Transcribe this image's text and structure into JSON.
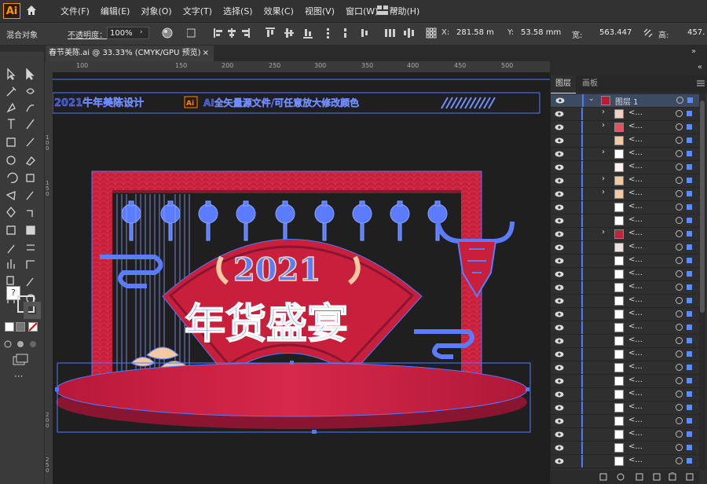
{
  "app": {
    "logo": "Ai"
  },
  "menu": [
    "文件(F)",
    "编辑(E)",
    "对象(O)",
    "文字(T)",
    "选择(S)",
    "效果(C)",
    "视图(V)",
    "窗口(W)",
    "帮助(H)"
  ],
  "control": {
    "mode": "混合对象",
    "opacity_label": "不透明度：",
    "opacity_value": "100%",
    "x_label": "X:",
    "x_value": "281.58 m",
    "y_label": "Y:",
    "y_value": "53.58 mm",
    "w_label": "宽:",
    "w_value": "563.447",
    "h_label": "高:",
    "h_value": "457."
  },
  "doc_tab": {
    "title": "春节美陈.ai @ 33.33% (CMYK/GPU 预览)",
    "close": "×"
  },
  "ruler": {
    "h_ticks": [
      "100",
      "150",
      "200",
      "250",
      "300",
      "350",
      "400",
      "450",
      "500"
    ],
    "v_ticks": [
      "1\n0\n0",
      "1\n5\n0",
      "2\n0\n0",
      "2\n5\n0"
    ]
  },
  "artwork": {
    "banner_left": "2021牛年美陈设计",
    "banner_ai": "Ai",
    "banner_right": "AI全矢量源文件/可任意放大修改颜色",
    "year": "2021",
    "title": "年货盛宴"
  },
  "panel": {
    "tab_layers": "图层",
    "tab_artboards": "画板",
    "layer1": "图层 1",
    "sublabel": "<..."
  },
  "colors": {
    "selection": "#4d7bff",
    "red": "#c8203c",
    "darkred": "#8a1530"
  }
}
